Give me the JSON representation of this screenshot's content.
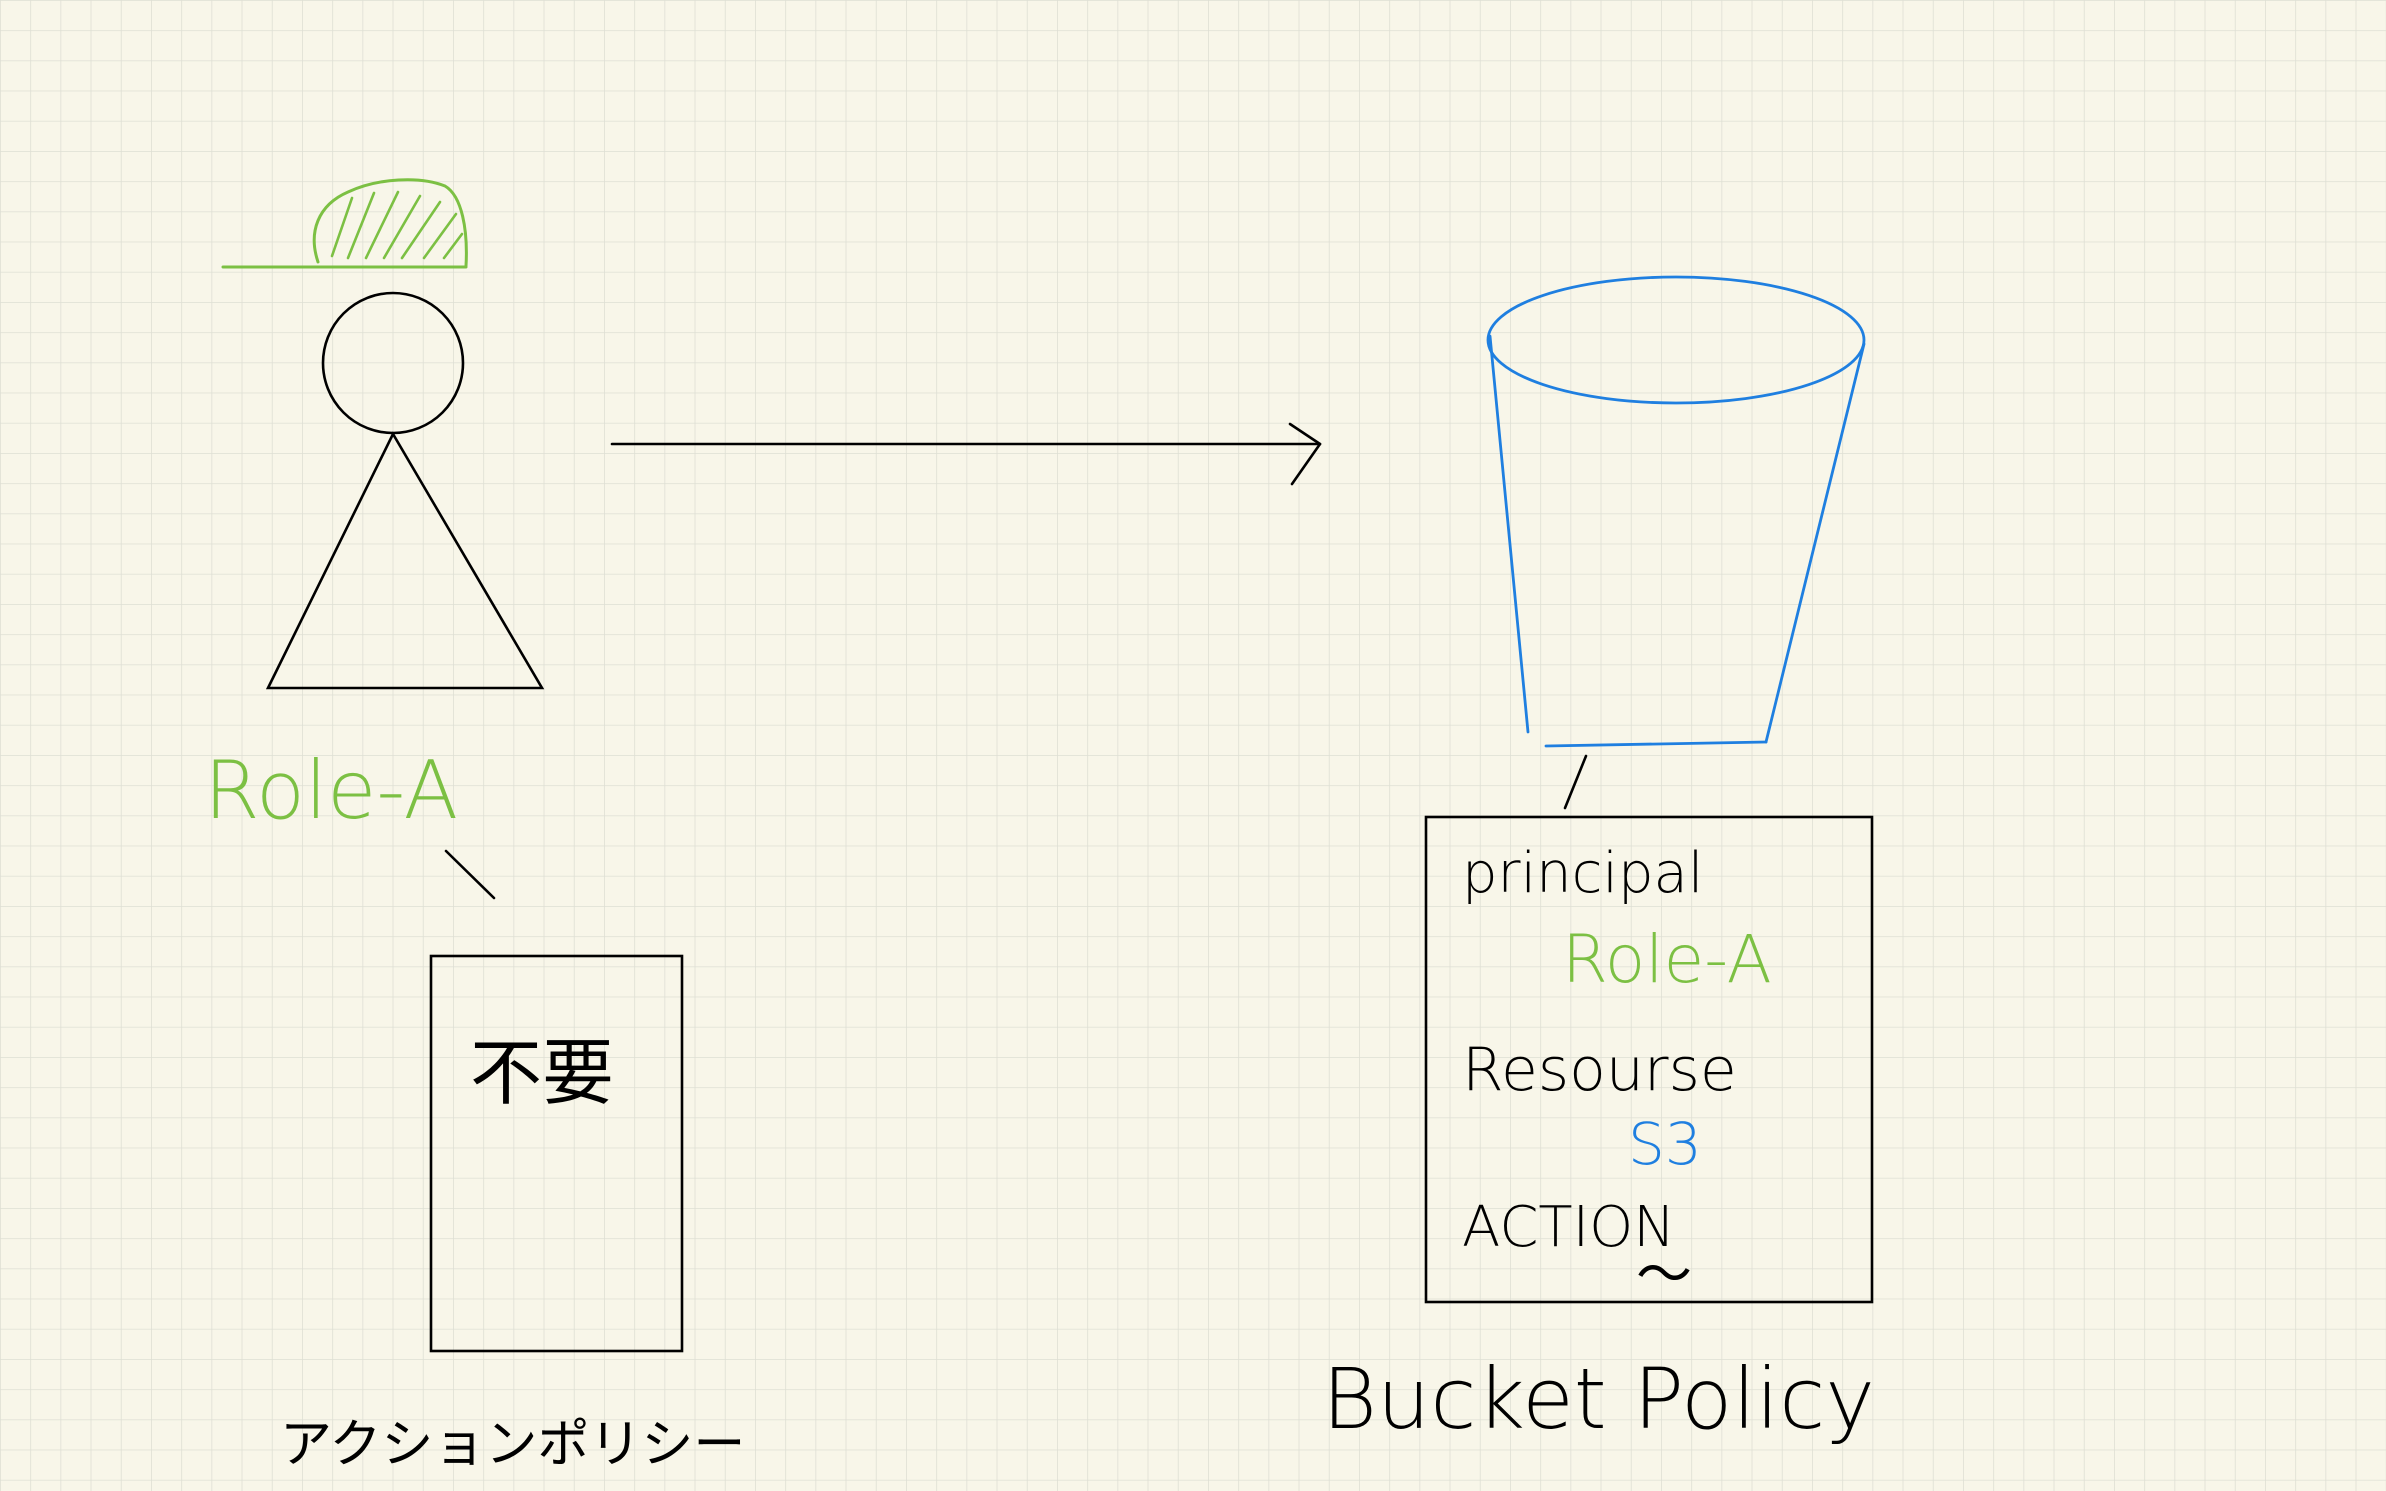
{
  "colors": {
    "background": "#f8f6e9",
    "grid": "#dedfd4",
    "ink": "#000000",
    "green": "#7cc043",
    "blue": "#1f7fe0"
  },
  "role_label": "Role-A",
  "action_policy": {
    "box_text": "不要",
    "caption": "アクションポリシー"
  },
  "bucket_policy": {
    "principal_label": "principal",
    "principal_value": "Role-A",
    "resource_label": "Resourse",
    "resource_value": "S3",
    "action_label": "ACTION",
    "action_value": "〜",
    "caption": "Bucket Policy"
  },
  "icons": {
    "person": "person-with-hat-icon",
    "bucket": "s3-bucket-icon"
  }
}
